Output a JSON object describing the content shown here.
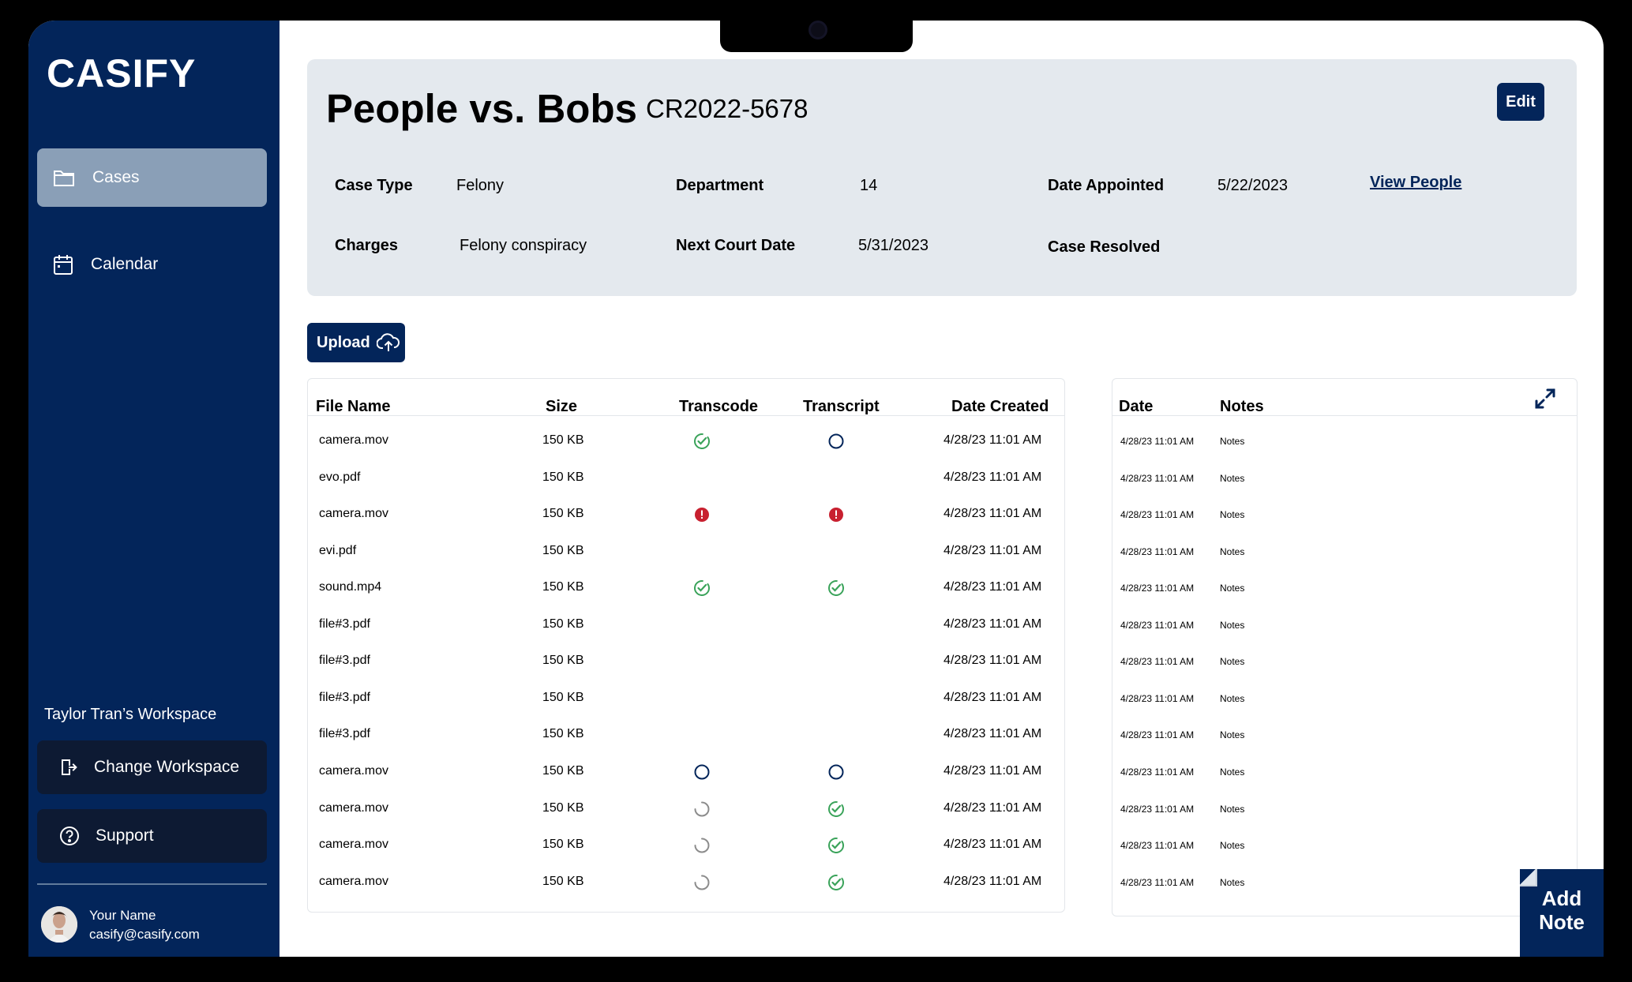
{
  "app": {
    "logo": "CASIFY",
    "accent": "#03255a",
    "nav_active_bg": "#8a9fb7"
  },
  "sidebar": {
    "items": [
      {
        "label": "Cases",
        "icon": "folder-icon",
        "active": true
      },
      {
        "label": "Calendar",
        "icon": "calendar-icon",
        "active": false
      }
    ],
    "workspace_label": "Taylor Tran’s Workspace",
    "change_workspace_label": "Change Workspace",
    "support_label": "Support",
    "user": {
      "name": "Your Name",
      "email": "casify@casify.com"
    }
  },
  "case": {
    "title": "People vs. Bobs",
    "number": "CR2022-5678",
    "edit_label": "Edit",
    "fields": {
      "case_type_label": "Case Type",
      "case_type_value": "Felony",
      "department_label": "Department",
      "department_value": "14",
      "date_appointed_label": "Date Appointed",
      "date_appointed_value": "5/22/2023",
      "charges_label": "Charges",
      "charges_value": "Felony conspiracy",
      "next_court_label": "Next Court Date",
      "next_court_value": "5/31/2023",
      "case_resolved_label": "Case Resolved"
    },
    "view_people_label": "View People"
  },
  "upload": {
    "label": "Upload"
  },
  "files": {
    "headers": [
      "File Name",
      "Size",
      "Transcode",
      "Transcript",
      "Date Created"
    ],
    "rows": [
      {
        "name": "camera.mov",
        "size": "150 KB",
        "transcode": "done",
        "transcript": "pending",
        "date": "4/28/23  11:01 AM"
      },
      {
        "name": "evo.pdf",
        "size": "150 KB",
        "transcode": "none",
        "transcript": "none",
        "date": "4/28/23  11:01 AM"
      },
      {
        "name": "camera.mov",
        "size": "150 KB",
        "transcode": "error",
        "transcript": "error",
        "date": "4/28/23  11:01 AM"
      },
      {
        "name": "evi.pdf",
        "size": "150 KB",
        "transcode": "none",
        "transcript": "none",
        "date": "4/28/23  11:01 AM"
      },
      {
        "name": "sound.mp4",
        "size": "150 KB",
        "transcode": "done",
        "transcript": "done",
        "date": "4/28/23  11:01 AM"
      },
      {
        "name": "file#3.pdf",
        "size": "150 KB",
        "transcode": "none",
        "transcript": "none",
        "date": "4/28/23  11:01 AM"
      },
      {
        "name": "file#3.pdf",
        "size": "150 KB",
        "transcode": "none",
        "transcript": "none",
        "date": "4/28/23  11:01 AM"
      },
      {
        "name": "file#3.pdf",
        "size": "150 KB",
        "transcode": "none",
        "transcript": "none",
        "date": "4/28/23  11:01 AM"
      },
      {
        "name": "file#3.pdf",
        "size": "150 KB",
        "transcode": "none",
        "transcript": "none",
        "date": "4/28/23  11:01 AM"
      },
      {
        "name": "camera.mov",
        "size": "150 KB",
        "transcode": "pending",
        "transcript": "pending",
        "date": "4/28/23  11:01 AM"
      },
      {
        "name": "camera.mov",
        "size": "150 KB",
        "transcode": "loading",
        "transcript": "done",
        "date": "4/28/23  11:01 AM"
      },
      {
        "name": "camera.mov",
        "size": "150 KB",
        "transcode": "loading",
        "transcript": "done",
        "date": "4/28/23  11:01 AM"
      },
      {
        "name": "camera.mov",
        "size": "150 KB",
        "transcode": "loading",
        "transcript": "done",
        "date": "4/28/23  11:01 AM"
      }
    ],
    "status_colors": {
      "done": "#3aa35a",
      "error": "#c8202f",
      "pending": "#03255a",
      "loading": "#8c8c8c"
    }
  },
  "notes": {
    "headers": [
      "Date",
      "Notes"
    ],
    "rows": [
      {
        "date": "4/28/23  11:01 AM",
        "note": "Notes"
      },
      {
        "date": "4/28/23  11:01 AM",
        "note": "Notes"
      },
      {
        "date": "4/28/23  11:01 AM",
        "note": "Notes"
      },
      {
        "date": "4/28/23  11:01 AM",
        "note": "Notes"
      },
      {
        "date": "4/28/23  11:01 AM",
        "note": "Notes"
      },
      {
        "date": "4/28/23  11:01 AM",
        "note": "Notes"
      },
      {
        "date": "4/28/23  11:01 AM",
        "note": "Notes"
      },
      {
        "date": "4/28/23  11:01 AM",
        "note": "Notes"
      },
      {
        "date": "4/28/23  11:01 AM",
        "note": "Notes"
      },
      {
        "date": "4/28/23  11:01 AM",
        "note": "Notes"
      },
      {
        "date": "4/28/23  11:01 AM",
        "note": "Notes"
      },
      {
        "date": "4/28/23  11:01 AM",
        "note": "Notes"
      },
      {
        "date": "4/28/23  11:01 AM",
        "note": "Notes"
      }
    ],
    "add_note_line1": "Add",
    "add_note_line2": "Note"
  }
}
